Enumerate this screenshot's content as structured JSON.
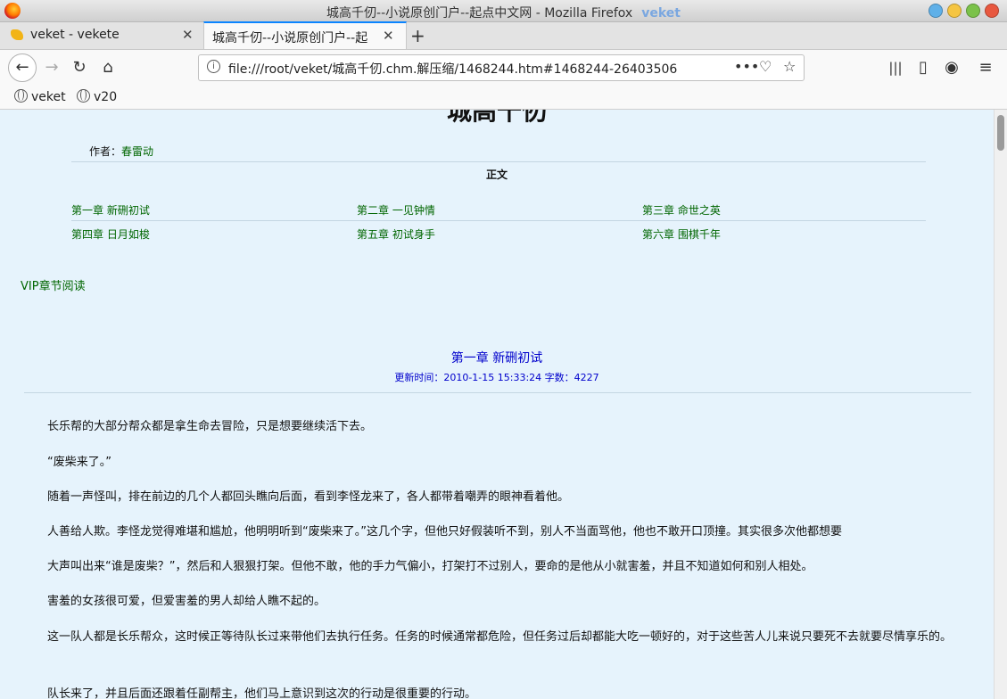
{
  "window": {
    "title": "城高千仞--小说原创门户--起点中文网 - Mozilla Firefox",
    "badge": "veket"
  },
  "tabs": [
    {
      "label": "veket - vekete",
      "active": false
    },
    {
      "label": "城高千仞--小说原创门户--起",
      "active": true
    }
  ],
  "toolbar": {
    "url": "file:///root/veket/城高千仞.chm.解压缩/1468244.htm#1468244-26403506"
  },
  "bookmarks": [
    {
      "label": "veket"
    },
    {
      "label": "v20"
    }
  ],
  "page": {
    "book_title": "城高千仞",
    "author_label": "作者：",
    "author_name": "春雷动",
    "section_label": "正文",
    "chapters": [
      "第一章 新硎初试",
      "第二章 一见钟情",
      "第三章 命世之英",
      "第四章 日月如梭",
      "第五章 初试身手",
      "第六章 围棋千年"
    ],
    "vip_link": "VIP章节阅读",
    "chapter_title": "第一章 新硎初试",
    "chapter_meta": "更新时间：2010-1-15 15:33:24 字数：4227",
    "paragraphs": [
      "长乐帮的大部分帮众都是拿生命去冒险，只是想要继续活下去。",
      "“废柴来了。”",
      "随着一声怪叫，排在前边的几个人都回头瞧向后面，看到李怪龙来了，各人都带着嘲弄的眼神看着他。",
      "人善给人欺。李怪龙觉得难堪和尴尬，他明明听到“废柴来了。”这几个字，但他只好假装听不到，别人不当面骂他，他也不敢开口顶撞。其实很多次他都想要",
      "大声叫出来“谁是废柴？”，然后和人狠狠打架。但他不敢，他的手力气偏小，打架打不过别人，要命的是他从小就害羞，并且不知道如何和别人相处。",
      "害羞的女孩很可爱，但爱害羞的男人却给人瞧不起的。",
      "这一队人都是长乐帮众，这时候正等待队长过来带他们去执行任务。任务的时候通常都危险，但任务过后却都能大吃一顿好的，对于这些苦人儿来说只要死不去就要尽情享乐的。",
      "队长来了，并且后面还跟着任副帮主，他们马上意识到这次的行动是很重要的行动。"
    ]
  }
}
